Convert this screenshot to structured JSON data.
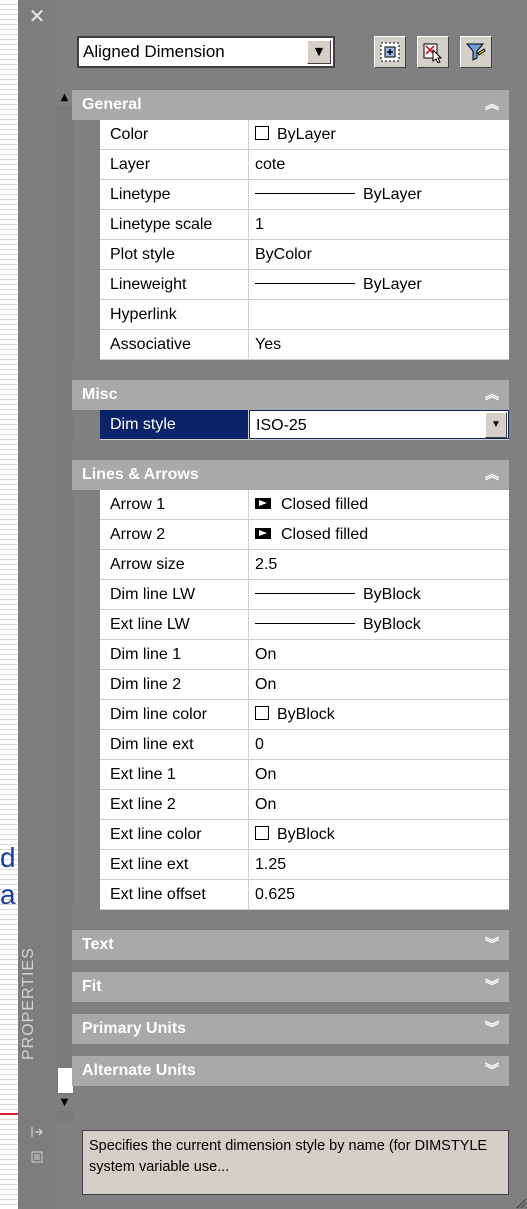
{
  "background": {
    "line1": "d",
    "line2": "a"
  },
  "palette": {
    "title": "PROPERTIES",
    "close_glyph": "✕",
    "object_type": "Aligned Dimension"
  },
  "groups": [
    {
      "title": "General",
      "expanded": true,
      "rows": [
        {
          "name": "Color",
          "value": "ByLayer",
          "kind": "color"
        },
        {
          "name": "Layer",
          "value": "cote",
          "kind": "text"
        },
        {
          "name": "Linetype",
          "value": "ByLayer",
          "kind": "line"
        },
        {
          "name": "Linetype scale",
          "value": "1",
          "kind": "text"
        },
        {
          "name": "Plot style",
          "value": "ByColor",
          "kind": "text"
        },
        {
          "name": "Lineweight",
          "value": "ByLayer",
          "kind": "line"
        },
        {
          "name": "Hyperlink",
          "value": "",
          "kind": "text"
        },
        {
          "name": "Associative",
          "value": "Yes",
          "kind": "text"
        }
      ]
    },
    {
      "title": "Misc",
      "expanded": true,
      "rows": [
        {
          "name": "Dim style",
          "value": "ISO-25",
          "kind": "select",
          "selected": true
        }
      ]
    },
    {
      "title": "Lines & Arrows",
      "expanded": true,
      "rows": [
        {
          "name": "Arrow 1",
          "value": "Closed filled",
          "kind": "arrow"
        },
        {
          "name": "Arrow 2",
          "value": "Closed filled",
          "kind": "arrow"
        },
        {
          "name": "Arrow size",
          "value": "2.5",
          "kind": "text"
        },
        {
          "name": "Dim line LW",
          "value": "ByBlock",
          "kind": "line"
        },
        {
          "name": "Ext line LW",
          "value": "ByBlock",
          "kind": "line"
        },
        {
          "name": "Dim line 1",
          "value": "On",
          "kind": "text"
        },
        {
          "name": "Dim line 2",
          "value": "On",
          "kind": "text"
        },
        {
          "name": "Dim line color",
          "value": "ByBlock",
          "kind": "color"
        },
        {
          "name": "Dim line ext",
          "value": "0",
          "kind": "text"
        },
        {
          "name": "Ext line 1",
          "value": "On",
          "kind": "text"
        },
        {
          "name": "Ext line 2",
          "value": "On",
          "kind": "text"
        },
        {
          "name": "Ext line color",
          "value": "ByBlock",
          "kind": "color"
        },
        {
          "name": "Ext line ext",
          "value": "1.25",
          "kind": "text"
        },
        {
          "name": "Ext line offset",
          "value": "0.625",
          "kind": "text"
        }
      ]
    },
    {
      "title": "Text",
      "expanded": false,
      "rows": []
    },
    {
      "title": "Fit",
      "expanded": false,
      "rows": []
    },
    {
      "title": "Primary Units",
      "expanded": false,
      "rows": []
    },
    {
      "title": "Alternate Units",
      "expanded": false,
      "rows": []
    }
  ],
  "description": "Specifies the current dimension style by name (for DIMSTYLE system variable use...",
  "icons": {
    "close": "close-icon",
    "quick_select": "quick-select-icon",
    "pick_objects": "select-objects-icon",
    "toggle_pickadd": "filter-icon"
  },
  "colors": {
    "panel": "#808080",
    "group_header": "#a9a9a9",
    "selection": "#0a246a"
  }
}
